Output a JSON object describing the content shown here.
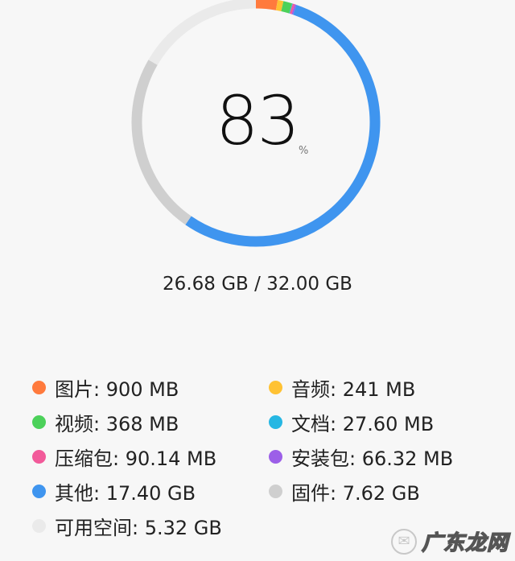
{
  "storage": {
    "percent": "83",
    "percent_sign": "%",
    "total": "26.68 GB / 32.00 GB",
    "used_fraction": 0.8338
  },
  "ring_segments": [
    {
      "name": "图片",
      "value_gb": 0.9,
      "color": "#ff7a3d"
    },
    {
      "name": "音频",
      "value_gb": 0.241,
      "color": "#ffc233"
    },
    {
      "name": "视频",
      "value_gb": 0.368,
      "color": "#4cd15a"
    },
    {
      "name": "文档",
      "value_gb": 0.0276,
      "color": "#26b7e3"
    },
    {
      "name": "压缩包",
      "value_gb": 0.09014,
      "color": "#f25a9a"
    },
    {
      "name": "安装包",
      "value_gb": 0.06632,
      "color": "#9c5fe8"
    },
    {
      "name": "其他",
      "value_gb": 17.4,
      "color": "#3f95ef"
    },
    {
      "name": "固件",
      "value_gb": 7.62,
      "color": "#cfcfcf"
    },
    {
      "name": "可用空间",
      "value_gb": 5.32,
      "color": "#eaeaea"
    }
  ],
  "legend": [
    {
      "label": "图片: 900 MB",
      "color": "#ff7a3d"
    },
    {
      "label": "音频: 241 MB",
      "color": "#ffc233"
    },
    {
      "label": "视频: 368 MB",
      "color": "#4cd15a"
    },
    {
      "label": "文档: 27.60 MB",
      "color": "#26b7e3"
    },
    {
      "label": "压缩包: 90.14 MB",
      "color": "#f25a9a"
    },
    {
      "label": "安装包: 66.32 MB",
      "color": "#9c5fe8"
    },
    {
      "label": "其他: 17.40 GB",
      "color": "#3f95ef"
    },
    {
      "label": "固件: 7.62 GB",
      "color": "#cfcfcf"
    },
    {
      "label": "可用空间: 5.32 GB",
      "color": "#eaeaea"
    }
  ],
  "watermark": {
    "text": "广东龙网",
    "icon": "message-icon"
  }
}
